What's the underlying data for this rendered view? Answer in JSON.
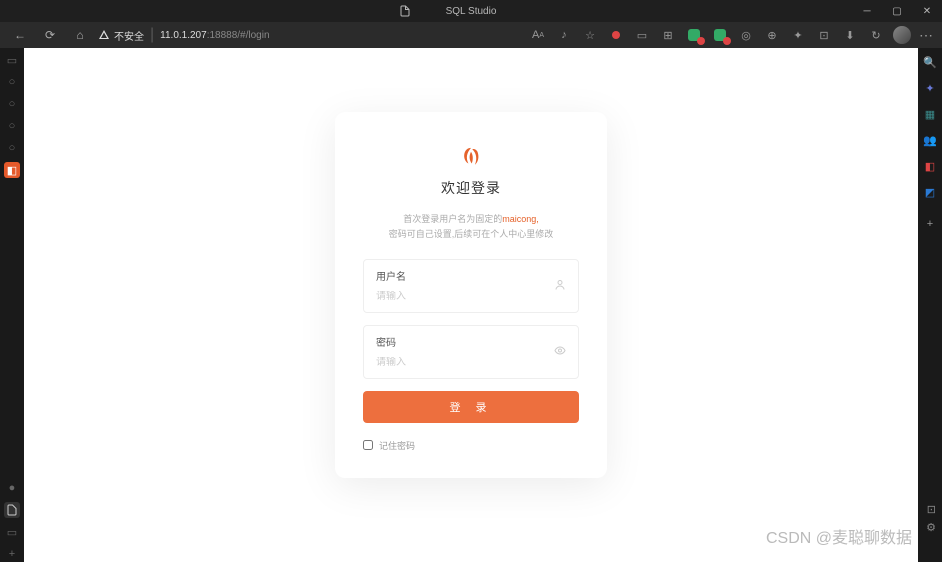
{
  "window": {
    "title": "SQL Studio"
  },
  "browser": {
    "security_label": "不安全",
    "url_host": "11.0.1.207",
    "url_path": ":18888/#/login"
  },
  "login": {
    "welcome": "欢迎登录",
    "hint_prefix": "首次登录用户名为固定的",
    "hint_accent": "maicong,",
    "hint_line2": "密码可自己设置,后续可在个人中心里修改",
    "username_label": "用户名",
    "username_placeholder": "请输入",
    "password_label": "密码",
    "password_placeholder": "请输入",
    "submit_label": "登 录",
    "remember_label": "记住密码"
  },
  "watermark": "CSDN @麦聪聊数据"
}
